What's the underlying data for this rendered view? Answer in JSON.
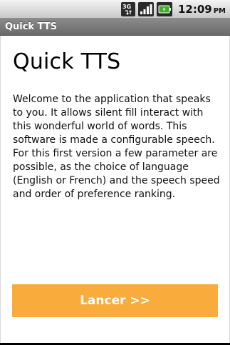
{
  "status_bar": {
    "network_type": "3G",
    "time": "12:09",
    "ampm": "PM",
    "icons": [
      "network-3g-icon",
      "signal-icon",
      "battery-icon"
    ]
  },
  "title_bar": {
    "title": "Quick TTS"
  },
  "main": {
    "heading": "Quick TTS",
    "description": "Welcome to the application that speaks to you. It allows silent fill interact with this wonderful world of words. This software is made a configurable speech. For this first version a few parameter are possible, as the choice of language (English or French) and the speech speed and order of preference ranking.",
    "launch_button_label": "Lancer >>"
  },
  "colors": {
    "accent": "#f9ac3c",
    "title_bar": "#7a7a7a",
    "battery": "#3fae2a"
  }
}
